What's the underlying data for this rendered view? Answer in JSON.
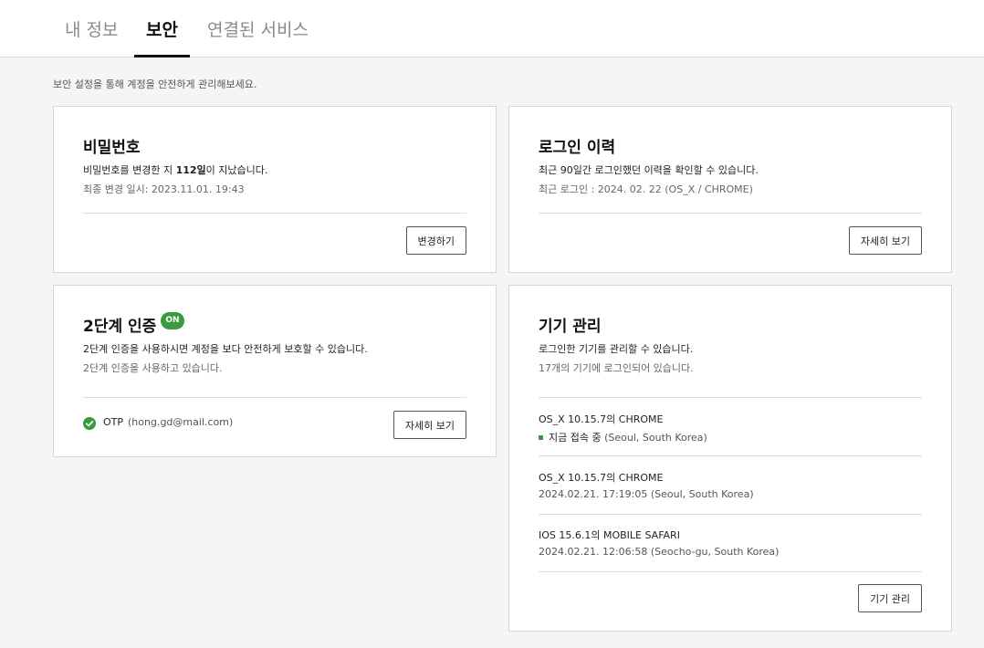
{
  "tabs": [
    {
      "label": "내 정보",
      "active": false
    },
    {
      "label": "보안",
      "active": true
    },
    {
      "label": "연결된 서비스",
      "active": false
    }
  ],
  "intro": "보안 설정을 통해 계정을 안전하게 관리해보세요.",
  "password_card": {
    "title": "비밀번호",
    "desc_before": "비밀번호를 변경한 지 ",
    "desc_days": "112일",
    "desc_after": "이 지났습니다.",
    "last_changed": "최종 변경 일시: 2023.11.01. 19:43",
    "button": "변경하기"
  },
  "login_history_card": {
    "title": "로그인 이력",
    "desc": "최근 90일간 로그인했던 이력을 확인할 수 있습니다.",
    "last_login": "최근 로그인 : 2024. 02. 22 (OS_X / CHROME)",
    "button": "자세히 보기"
  },
  "two_factor_card": {
    "title": "2단계 인증",
    "badge": "ON",
    "desc": "2단계 인증을 사용하시면 계정을 보다 안전하게 보호할 수 있습니다.",
    "status": "2단계 인증을 사용하고 있습니다.",
    "method": "OTP",
    "email": "(hong.gd@mail.com)",
    "button": "자세히 보기",
    "accent_color": "#3a9a3e"
  },
  "device_card": {
    "title": "기기 관리",
    "desc": "로그인한 기기를 관리할 수 있습니다.",
    "count_text": "17개의 기기에 로그인되어 있습니다.",
    "devices": [
      {
        "name": "OS_X 10.15.7의 CHROME",
        "live_label": "지금 접속 중",
        "location": " (Seoul, South Korea)"
      },
      {
        "name": "OS_X 10.15.7의 CHROME",
        "time_location": "2024.02.21. 17:19:05 (Seoul, South Korea)"
      },
      {
        "name": "IOS 15.6.1의 MOBILE SAFARI",
        "time_location": "2024.02.21. 12:06:58 (Seocho-gu, South Korea)"
      }
    ],
    "button": "기기 관리"
  },
  "icons": {
    "check": "check-circle-icon"
  }
}
